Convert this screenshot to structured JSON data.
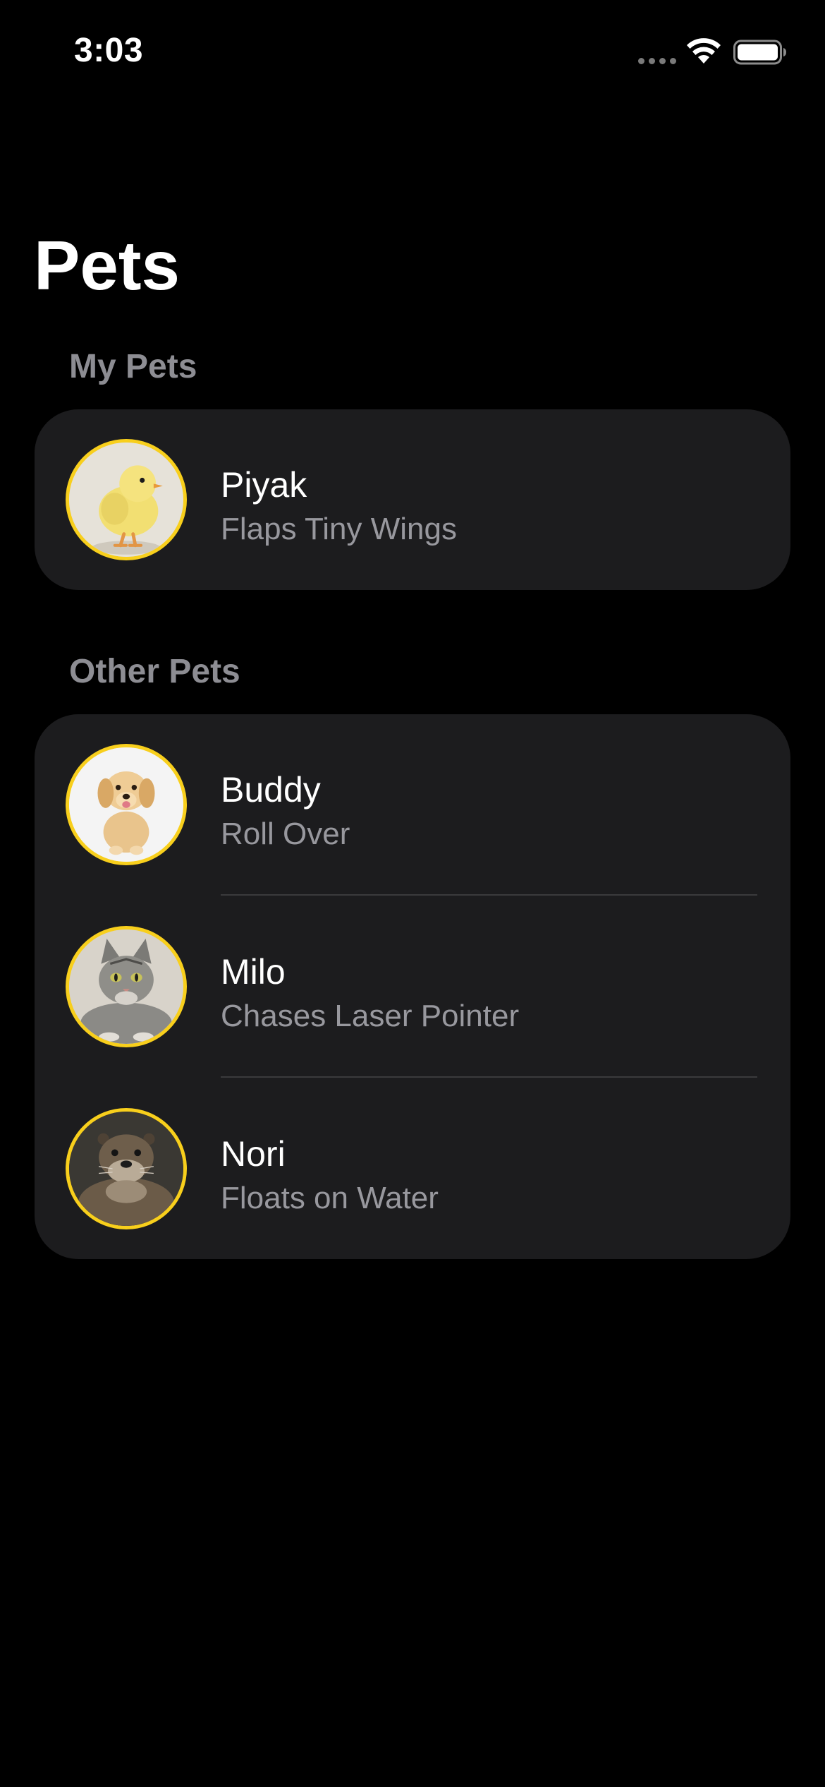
{
  "status_bar": {
    "time": "3:03"
  },
  "title": "Pets",
  "sections": {
    "my_pets": {
      "header": "My Pets",
      "pets": [
        {
          "name": "Piyak",
          "trick": "Flaps Tiny Wings",
          "avatar": "chick-photo"
        }
      ]
    },
    "other_pets": {
      "header": "Other Pets",
      "pets": [
        {
          "name": "Buddy",
          "trick": "Roll Over",
          "avatar": "puppy-photo"
        },
        {
          "name": "Milo",
          "trick": "Chases Laser Pointer",
          "avatar": "cat-photo"
        },
        {
          "name": "Nori",
          "trick": "Floats on Water",
          "avatar": "otter-photo"
        }
      ]
    }
  },
  "colors": {
    "background": "#000000",
    "card": "#1c1c1e",
    "avatar_ring": "#f8cf1c",
    "secondary_text": "#98989e",
    "section_header": "#8d8d93",
    "separator": "#3a3a3c"
  }
}
